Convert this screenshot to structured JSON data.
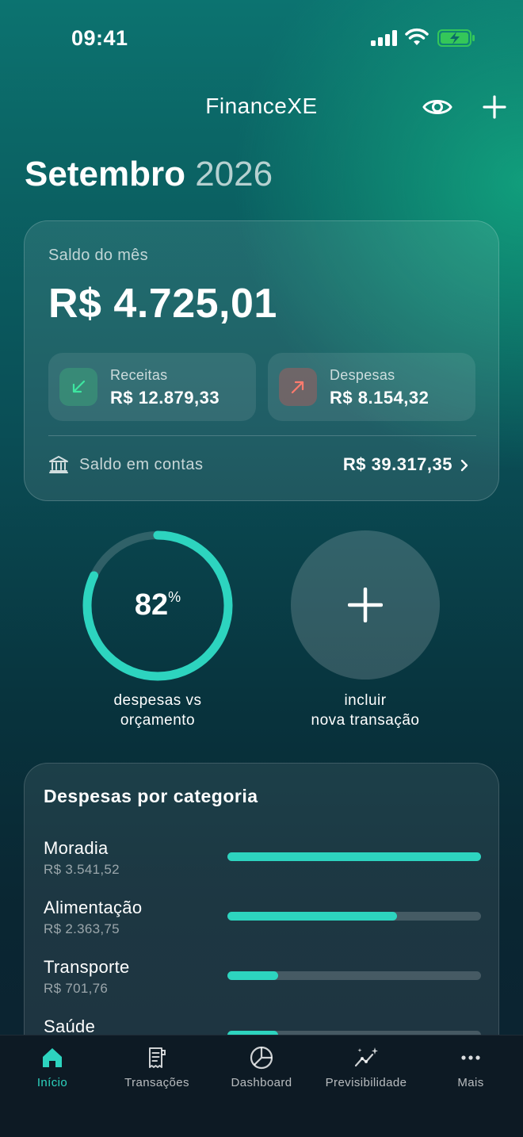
{
  "status_bar": {
    "time": "09:41"
  },
  "header": {
    "title": "FinanceXE"
  },
  "page": {
    "month": "Setembro",
    "year": "2026"
  },
  "summary": {
    "saldo_label": "Saldo do mês",
    "saldo_value": "R$ 4.725,01",
    "receitas_label": "Receitas",
    "receitas_value": "R$ 12.879,33",
    "despesas_label": "Despesas",
    "despesas_value": "R$ 8.154,32",
    "contas_label": "Saldo em contas",
    "contas_value": "R$ 39.317,35"
  },
  "budget": {
    "percent": "82",
    "percent_sign": "%",
    "progress": 0.82,
    "caption_line1": "despesas vs",
    "caption_line2": "orçamento"
  },
  "add": {
    "caption_line1": "incluir",
    "caption_line2": "nova transação"
  },
  "categories": {
    "title": "Despesas por categoria",
    "items": [
      {
        "name": "Moradia",
        "amount": "R$ 3.541,52",
        "share": 1.0
      },
      {
        "name": "Alimentação",
        "amount": "R$ 2.363,75",
        "share": 0.67
      },
      {
        "name": "Transporte",
        "amount": "R$ 701,76",
        "share": 0.2
      },
      {
        "name": "Saúde",
        "amount": "",
        "share": 0.2
      }
    ]
  },
  "tabs": [
    {
      "label": "Início",
      "icon": "home-icon",
      "active": true
    },
    {
      "label": "Transações",
      "icon": "receipt-icon",
      "active": false
    },
    {
      "label": "Dashboard",
      "icon": "pie-chart-icon",
      "active": false
    },
    {
      "label": "Previsibilidade",
      "icon": "sparkle-trend-icon",
      "active": false
    },
    {
      "label": "Mais",
      "icon": "more-dots-icon",
      "active": false
    }
  ],
  "colors": {
    "accent": "#2dd4bf",
    "tab_bar": "#0d1a24"
  }
}
